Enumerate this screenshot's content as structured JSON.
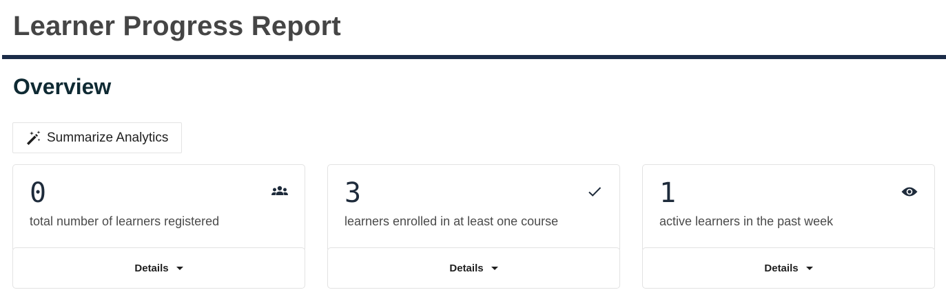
{
  "header": {
    "title": "Learner Progress Report",
    "rule_color": "#1b2c48"
  },
  "overview": {
    "title": "Overview",
    "summarize_button": {
      "label": "Summarize Analytics",
      "icon": "magic-wand-icon"
    }
  },
  "stats": [
    {
      "value": "0",
      "description": "total number of learners registered",
      "icon": "people-group-icon",
      "details_label": "Details"
    },
    {
      "value": "3",
      "description": "learners enrolled in at least one course",
      "icon": "checkmark-icon",
      "details_label": "Details"
    },
    {
      "value": "1",
      "description": "active learners in the past week",
      "icon": "eye-icon",
      "details_label": "Details"
    }
  ]
}
